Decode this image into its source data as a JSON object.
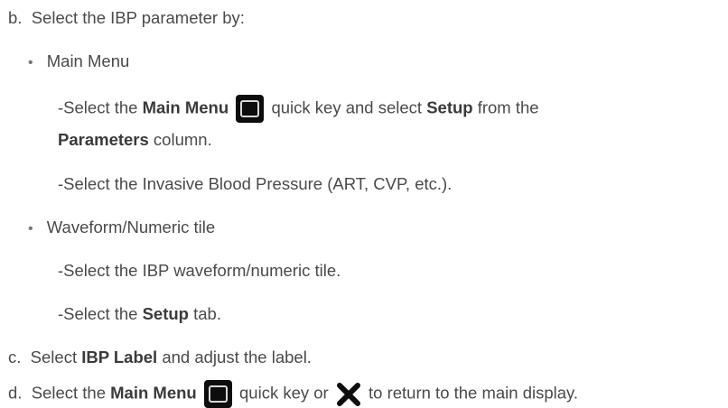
{
  "steps": {
    "b": {
      "letter": "b.",
      "text": "Select the IBP parameter by:",
      "option1": {
        "bullet": "•",
        "title": "Main Menu",
        "line1_pre": "-Select the ",
        "line1_bold": "Main Menu",
        "line1_post": " quick key and select ",
        "line1_bold2": "Setup",
        "line1_end": " from the",
        "line2_bold": "Parameters",
        "line2_end": " column.",
        "line3": "-Select the Invasive Blood Pressure (ART, CVP, etc.)."
      },
      "option2": {
        "bullet": "•",
        "title": "Waveform/Numeric tile",
        "line1": "-Select the IBP waveform/numeric tile.",
        "line2_pre": "-Select the ",
        "line2_bold": "Setup",
        "line2_end": " tab."
      }
    },
    "c": {
      "letter": "c.",
      "pre": "Select ",
      "bold": "IBP Label",
      "post": " and adjust the label."
    },
    "d": {
      "letter": "d.",
      "pre": "Select the ",
      "bold": "Main Menu",
      "mid": " quick key or ",
      "post": " to return to the main display."
    }
  },
  "icons": {
    "quick_key": "main-menu-quick-key-icon",
    "close": "close-x-icon"
  },
  "colors": {
    "text": "#4a4a4a",
    "key_bg": "#0d0d0d"
  }
}
